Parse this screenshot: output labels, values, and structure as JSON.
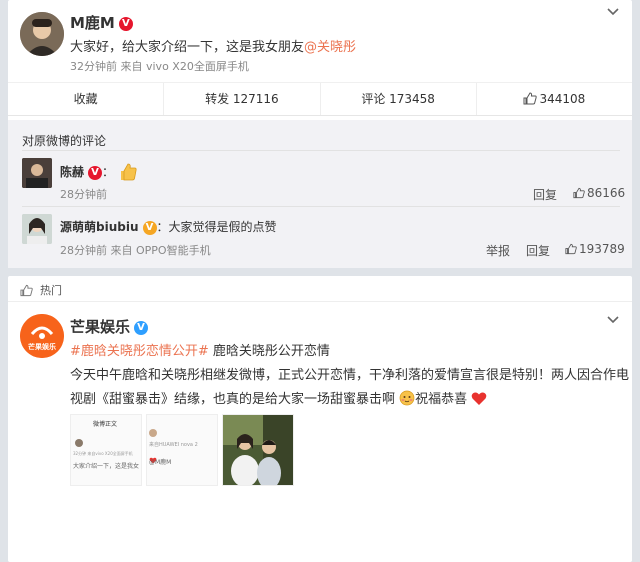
{
  "post1": {
    "author": "M鹿M",
    "text_prefix": "大家好，给大家介绍一下，这是我女朋友",
    "mention": "@关晓彤",
    "meta": "32分钟前 来自 vivo X20全面屏手机",
    "actions": {
      "favorite": "收藏",
      "repost": "转发 127116",
      "comment": "评论 173458",
      "like": "344108"
    },
    "comments_header": "对原微博的评论",
    "comments": [
      {
        "user": "陈赫",
        "colon": "：",
        "time": "28分钟前",
        "reply": "回复",
        "likes": "86166"
      },
      {
        "user": "源萌萌biubiu",
        "colon": "：",
        "text": "大家觉得是假的点赞",
        "meta": "28分钟前 来自 OPPO智能手机",
        "report": "举报",
        "reply": "回复",
        "likes": "193789"
      }
    ]
  },
  "post2": {
    "hot_label": "热门",
    "author": "芒果娱乐",
    "logo_text": "芒果娱乐",
    "topic": "#鹿晗关晓彤恋情公开#",
    "topic_rest": " 鹿晗关晓彤公开恋情",
    "line1": "今天中午鹿晗和关晓彤相继发微博，正式公开恋情，干净利落的爱情宣言很是特别！两人因合作电",
    "line2a": "视剧《甜蜜暴击》结缘，也真的是给大家一场甜蜜暴击啊",
    "line2b": "祝福恭喜",
    "thumb1": {
      "title": "微博正文",
      "meta": "32分钟 来自vivo X20全面屏手机",
      "text": "大家介绍一下，这是我女"
    },
    "thumb2": {
      "meta": "来自HUAWEI nova 2",
      "text": "@M鹿M"
    }
  },
  "colors": {
    "link": "#eb7350",
    "topic": "#eb7350",
    "verified_red": "#e6162d",
    "verified_gold": "#f5a623",
    "verified_blue": "#2e9fff",
    "mango_orange": "#f7631b"
  }
}
